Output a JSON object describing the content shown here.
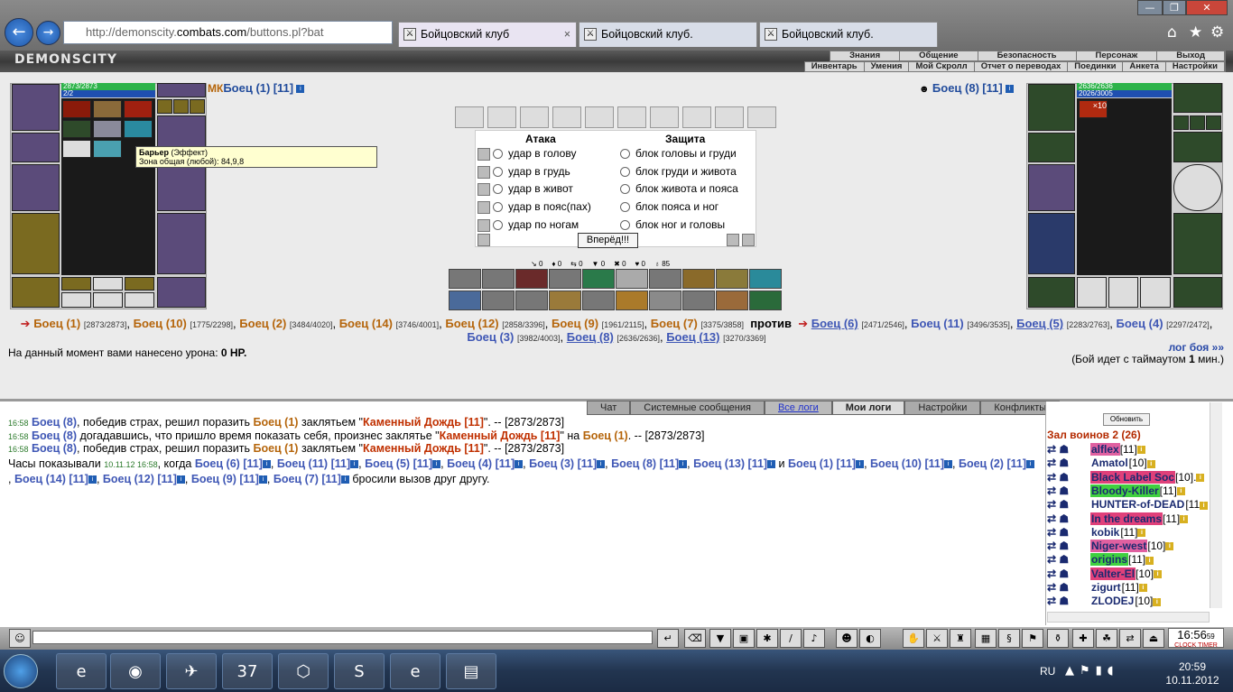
{
  "browser": {
    "url_prefix": "http://demonscity.",
    "url_domain": "combats.com",
    "url_suffix": "/buttons.pl?bat",
    "tabs": [
      {
        "label": "Бойцовский клуб"
      },
      {
        "label": "Бойцовский клуб."
      },
      {
        "label": "Бойцовский клуб."
      }
    ],
    "back_icon": "arrow-left",
    "forward_icon": "arrow-right",
    "window_buttons": [
      "—",
      "❐",
      "✕"
    ]
  },
  "game": {
    "logo": "DEMONSCITY",
    "menu_row1": [
      "Знания",
      "Общение",
      "Безопасность",
      "Персонаж",
      "Выход"
    ],
    "menu_row2": [
      "Инвентарь",
      "Умения",
      "Мой Скролл",
      "Отчет о переводах",
      "Поединки",
      "Анкета",
      "Настройки"
    ]
  },
  "left_fighter": {
    "hp": "2873/2873",
    "mp": "2/2",
    "name": "Боец (1)",
    "level": "[11]",
    "badge": "МК"
  },
  "right_fighter": {
    "hp": "2636/2636",
    "mp": "2026/3005",
    "name": "Боец (8)",
    "level": "[11]",
    "effect_badge": "×10"
  },
  "tooltip": {
    "title": "Барьер",
    "type": "(Эффект)",
    "line": "Зона общая (любой): 84,9,8"
  },
  "combat": {
    "attack_header": "Атака",
    "defense_header": "Защита",
    "attacks": [
      "удар в голову",
      "удар в грудь",
      "удар в живот",
      "удар в пояс(пах)",
      "удар по ногам"
    ],
    "blocks": [
      "блок головы и груди",
      "блок груди и живота",
      "блок живота и пояса",
      "блок пояса и ног",
      "блок ног и головы"
    ],
    "forward_button": "Вперёд!!!",
    "stats": [
      "0",
      "0",
      "0",
      "0",
      "0",
      "0",
      "85"
    ]
  },
  "teams": {
    "team1": [
      {
        "name": "Боец (1)",
        "hp": "[2873/2873]"
      },
      {
        "name": "Боец (10)",
        "hp": "[1775/2298]"
      },
      {
        "name": "Боец (2)",
        "hp": "[3484/4020]"
      },
      {
        "name": "Боец (14)",
        "hp": "[3746/4001]"
      },
      {
        "name": "Боец (12)",
        "hp": "[2858/3396]"
      },
      {
        "name": "Боец (9)",
        "hp": "[1961/2115]"
      },
      {
        "name": "Боец (7)",
        "hp": "[3375/3858]"
      }
    ],
    "versus": "против",
    "team2": [
      {
        "name": "Боец (6)",
        "hp": "[2471/2546]"
      },
      {
        "name": "Боец (11)",
        "hp": "[3496/3535]"
      },
      {
        "name": "Боец (5)",
        "hp": "[2283/2763]"
      },
      {
        "name": "Боец (4)",
        "hp": "[2297/2472]"
      },
      {
        "name": "Боец (3)",
        "hp": "[3982/4003]"
      },
      {
        "name": "Боец (8)",
        "hp": "[2636/2636]"
      },
      {
        "name": "Боец (13)",
        "hp": "[3270/3369]"
      }
    ]
  },
  "damage": {
    "prefix": "На данный момент вами нанесено урона: ",
    "value": "0 HP."
  },
  "battle_log_link": "лог боя »»",
  "timeout": {
    "prefix": "(Бой идет с таймаутом ",
    "value": "1",
    "suffix": " мин.)"
  },
  "chat": {
    "tabs": [
      "Чат",
      "Системные сообщения",
      "Все логи",
      "Мои логи",
      "Настройки",
      "Конфликты"
    ],
    "lines": [
      {
        "time": "16:58",
        "actor": "Боец (8)",
        "text1": ", победив страх, решил поразить ",
        "target": "Боец (1)",
        "text2": " заклятьем \"",
        "spell": "Каменный Дождь [11]",
        "text3": "\". -- [2873/2873]"
      },
      {
        "time": "16:58",
        "actor": "Боец (8)",
        "text1": " догадавшись, что пришло время показать себя, произнес заклятье \"",
        "target": "Каменный Дождь [11]",
        "text2": "\" на ",
        "spell": "Боец (1)",
        "text3": ". -- [2873/2873]"
      },
      {
        "time": "16:58",
        "actor": "Боец (8)",
        "text1": ", победив страх, решил поразить ",
        "target": "Боец (1)",
        "text2": " заклятьем \"",
        "spell": "Каменный Дождь [11]",
        "text3": "\". -- [2873/2873]"
      }
    ],
    "clock_line": {
      "prefix": "Часы показывали ",
      "time": "10.11.12 16:58",
      "mid": ", когда ",
      "names": [
        "Боец (6)",
        "Боец (11)",
        "Боец (5)",
        "Боец (4)",
        "Боец (3)",
        "Боец (8)",
        "Боец (13)",
        "Боец (1)",
        "Боец (10)",
        "Боец (2)",
        "Боец (14)",
        "Боец (12)",
        "Боец (9)",
        "Боец (7)"
      ],
      "level": "[11]",
      "and": " и ",
      "suffix": " бросили вызов друг другу."
    }
  },
  "room": {
    "refresh": "Обновить",
    "title": "Зал воинов 2 (26)",
    "players": [
      {
        "name": "alflex",
        "level": "[11]",
        "bg": "#e060a0"
      },
      {
        "name": "Amatol",
        "level": "[10]",
        "bg": ""
      },
      {
        "name": "Black Label Soc",
        "level": "[10].",
        "bg": "#e0407a"
      },
      {
        "name": "Bloody-Killer",
        "level": "[11]",
        "bg": "#40d040"
      },
      {
        "name": "HUNTER-of-DEAD",
        "level": "[11",
        "bg": ""
      },
      {
        "name": "In the dreams",
        "level": "[11]",
        "bg": "#e0407a"
      },
      {
        "name": "kobik",
        "level": "[11]",
        "bg": ""
      },
      {
        "name": "Niger-west",
        "level": "[10]",
        "bg": "#e060a0"
      },
      {
        "name": "origins",
        "level": "[11]",
        "bg": "#40d040"
      },
      {
        "name": "Valter-El",
        "level": "[10]",
        "bg": "#e0407a"
      },
      {
        "name": "zigurt",
        "level": "[11]",
        "bg": ""
      },
      {
        "name": "ZLODEJ",
        "level": "[10]",
        "bg": ""
      }
    ]
  },
  "bottom_clock": {
    "time": "16:56",
    "seconds": "59",
    "labels": "CLOCK TIMER"
  },
  "taskbar": {
    "lang": "RU",
    "time": "20:59",
    "date": "10.11.2012",
    "apps": [
      "e",
      "◉",
      "✈",
      "37",
      "⬡",
      "S",
      "e",
      "▤"
    ]
  },
  "colors": {
    "link_blue": "#224c9c",
    "link_brown": "#b5650b",
    "spell_red": "#c03000",
    "room_title": "#b42a00"
  }
}
